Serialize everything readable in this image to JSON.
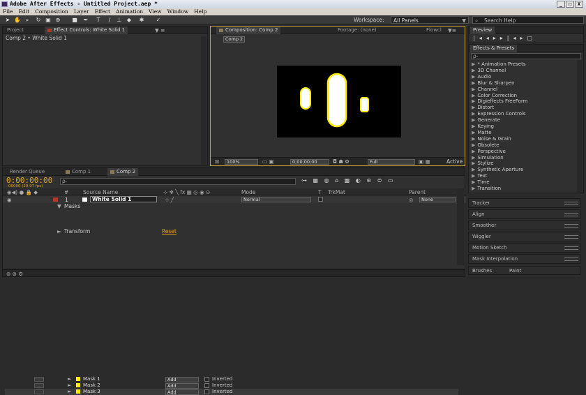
{
  "window": {
    "title": "Adobe After Effects - Untitled Project.aep *",
    "buttons": [
      "_",
      "□",
      "X"
    ]
  },
  "menu": [
    "File",
    "Edit",
    "Composition",
    "Layer",
    "Effect",
    "Animation",
    "View",
    "Window",
    "Help"
  ],
  "toolbar": {
    "workspace_label": "Workspace:",
    "workspace_value": "All Panels",
    "search_placeholder": "Search Help"
  },
  "project_panel": {
    "tab_project": "Project",
    "tab_effect_controls": "Effect Controls: White Solid 1",
    "breadcrumb": "Comp 2 • White Solid 1"
  },
  "viewer": {
    "tab_composition": "Composition: Comp 2",
    "tab_footage": "Footage: (none)",
    "tab_flowchart": "Flowcl",
    "comp_button": "Comp 2",
    "zoom": "100%",
    "timecode": "0;00;00;00",
    "resolution": "Full",
    "active": "Active"
  },
  "preview": {
    "tab": "Preview"
  },
  "effects": {
    "tab": "Effects & Presets",
    "search_placeholder": "ρ-",
    "items": [
      "* Animation Presets",
      "3D Channel",
      "Audio",
      "Blur & Sharpen",
      "Channel",
      "Color Correction",
      "Digieffects FreeForm",
      "Distort",
      "Expression Controls",
      "Generate",
      "Keying",
      "Matte",
      "Noise & Grain",
      "Obsolete",
      "Perspective",
      "Simulation",
      "Stylize",
      "Synthetic Aperture",
      "Text",
      "Time",
      "Transition"
    ]
  },
  "right_panels": [
    "Tracker",
    "Align",
    "Smoother",
    "Wiggler",
    "Motion Sketch",
    "Mask Interpolation"
  ],
  "brushes": {
    "tab1": "Brushes",
    "tab2": "Paint"
  },
  "timeline": {
    "tab_render": "Render Queue",
    "tab_comp1": "Comp 1",
    "tab_comp2": "Comp 2",
    "timecode": "0:00:00:00",
    "fps": "00000 (29.97 fps)",
    "search_placeholder": "ρ-",
    "col_number": "#",
    "col_source": "Source Name",
    "col_mode": "Mode",
    "col_t": "T",
    "col_trkmat": "TrkMat",
    "col_parent": "Parent",
    "layer": {
      "number": "1",
      "name": "White Solid 1",
      "mode": "Normal",
      "parent": "None"
    },
    "masks_label": "Masks",
    "masks": [
      {
        "name": "Mask 1",
        "mode": "Add",
        "inverted": "Inverted"
      },
      {
        "name": "Mask 2",
        "mode": "Add",
        "inverted": "Inverted"
      },
      {
        "name": "Mask 3",
        "mode": "Add",
        "inverted": "Inverted"
      }
    ],
    "transform_label": "Transform",
    "reset_label": "Reset"
  },
  "colors": {
    "mask_yellow": "#ffea00",
    "timecode_orange": "#e8a317",
    "viewer_border": "#c9a13a",
    "panel_bg": "#303030"
  }
}
